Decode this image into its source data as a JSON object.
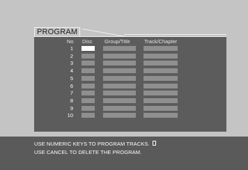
{
  "screen": {
    "title": "PROGRAM"
  },
  "columns": {
    "no": "No",
    "disc": "Disc",
    "group": "Group/Title",
    "track": "Track/Chapter"
  },
  "rows": [
    {
      "no": "1",
      "active": true
    },
    {
      "no": "2",
      "active": false
    },
    {
      "no": "3",
      "active": false
    },
    {
      "no": "4",
      "active": false
    },
    {
      "no": "5",
      "active": false
    },
    {
      "no": "6",
      "active": false
    },
    {
      "no": "7",
      "active": false
    },
    {
      "no": "8",
      "active": false
    },
    {
      "no": "9",
      "active": false
    },
    {
      "no": "10",
      "active": false
    }
  ],
  "messages": {
    "line1": "USE NUMERIC KEYS TO PROGRAM TRACKS.",
    "line2": "USE CANCEL TO DELETE THE PROGRAM."
  },
  "colors": {
    "background": "#c4c4c4",
    "panel": "#5c5c5c",
    "field": "#8f8f8f",
    "selected_field": "#ffffff"
  }
}
